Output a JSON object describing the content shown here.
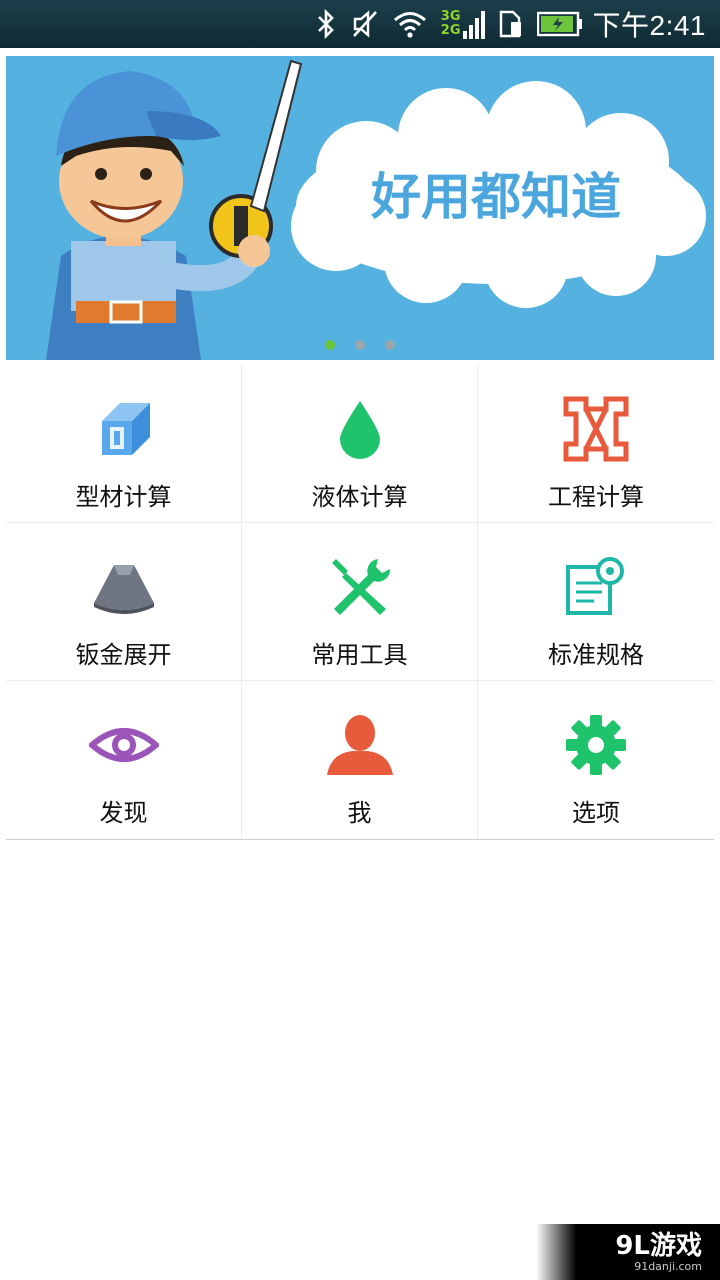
{
  "status_bar": {
    "net_top": "3G",
    "net_bottom": "2G",
    "time": "下午2:41",
    "icons": [
      "bluetooth-icon",
      "vibrate-mute-icon",
      "wifi-icon",
      "signal-icon",
      "sim-icon",
      "battery-icon"
    ]
  },
  "banner": {
    "slogan": "好用都知道",
    "active_slide": 1,
    "slide_count": 3
  },
  "menu": {
    "items": [
      {
        "label": "型材计算",
        "icon": "profile-beam-icon",
        "color": "#4a9ee6"
      },
      {
        "label": "液体计算",
        "icon": "droplet-icon",
        "color": "#1fc36b"
      },
      {
        "label": "工程计算",
        "icon": "truss-icon",
        "color": "#e85a3c"
      },
      {
        "label": "钣金展开",
        "icon": "sheet-metal-icon",
        "color": "#6f7583"
      },
      {
        "label": "常用工具",
        "icon": "tools-icon",
        "color": "#1fc36b"
      },
      {
        "label": "标准规格",
        "icon": "document-gear-icon",
        "color": "#1fb8a8"
      },
      {
        "label": "发现",
        "icon": "eye-icon",
        "color": "#9b54b8"
      },
      {
        "label": "我",
        "icon": "user-icon",
        "color": "#e85a3c"
      },
      {
        "label": "选项",
        "icon": "gear-icon",
        "color": "#1fc36b"
      }
    ]
  },
  "watermark": {
    "brand": "9L游戏",
    "url": "91danji.com"
  }
}
